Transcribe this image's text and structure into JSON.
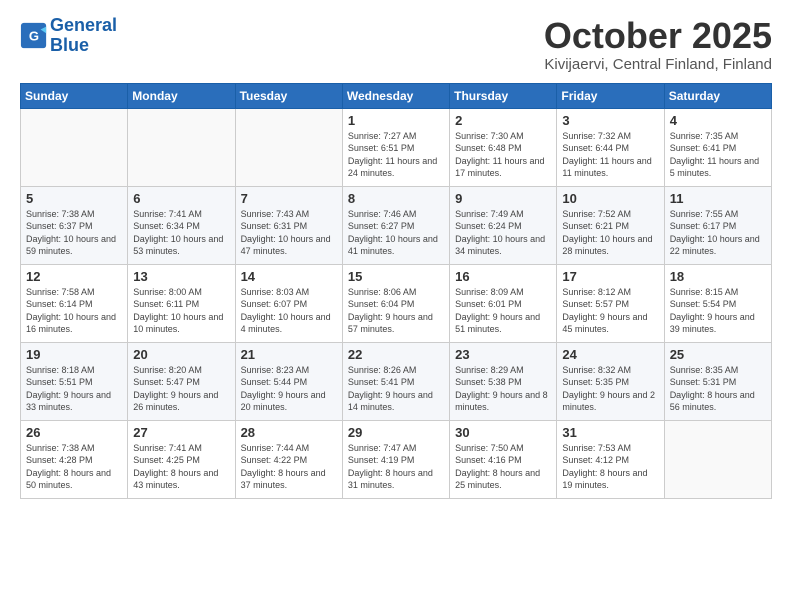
{
  "header": {
    "logo_line1": "General",
    "logo_line2": "Blue",
    "month": "October 2025",
    "location": "Kivijaervi, Central Finland, Finland"
  },
  "days_of_week": [
    "Sunday",
    "Monday",
    "Tuesday",
    "Wednesday",
    "Thursday",
    "Friday",
    "Saturday"
  ],
  "weeks": [
    [
      {
        "day": "",
        "info": ""
      },
      {
        "day": "",
        "info": ""
      },
      {
        "day": "",
        "info": ""
      },
      {
        "day": "1",
        "info": "Sunrise: 7:27 AM\nSunset: 6:51 PM\nDaylight: 11 hours\nand 24 minutes."
      },
      {
        "day": "2",
        "info": "Sunrise: 7:30 AM\nSunset: 6:48 PM\nDaylight: 11 hours\nand 17 minutes."
      },
      {
        "day": "3",
        "info": "Sunrise: 7:32 AM\nSunset: 6:44 PM\nDaylight: 11 hours\nand 11 minutes."
      },
      {
        "day": "4",
        "info": "Sunrise: 7:35 AM\nSunset: 6:41 PM\nDaylight: 11 hours\nand 5 minutes."
      }
    ],
    [
      {
        "day": "5",
        "info": "Sunrise: 7:38 AM\nSunset: 6:37 PM\nDaylight: 10 hours\nand 59 minutes."
      },
      {
        "day": "6",
        "info": "Sunrise: 7:41 AM\nSunset: 6:34 PM\nDaylight: 10 hours\nand 53 minutes."
      },
      {
        "day": "7",
        "info": "Sunrise: 7:43 AM\nSunset: 6:31 PM\nDaylight: 10 hours\nand 47 minutes."
      },
      {
        "day": "8",
        "info": "Sunrise: 7:46 AM\nSunset: 6:27 PM\nDaylight: 10 hours\nand 41 minutes."
      },
      {
        "day": "9",
        "info": "Sunrise: 7:49 AM\nSunset: 6:24 PM\nDaylight: 10 hours\nand 34 minutes."
      },
      {
        "day": "10",
        "info": "Sunrise: 7:52 AM\nSunset: 6:21 PM\nDaylight: 10 hours\nand 28 minutes."
      },
      {
        "day": "11",
        "info": "Sunrise: 7:55 AM\nSunset: 6:17 PM\nDaylight: 10 hours\nand 22 minutes."
      }
    ],
    [
      {
        "day": "12",
        "info": "Sunrise: 7:58 AM\nSunset: 6:14 PM\nDaylight: 10 hours\nand 16 minutes."
      },
      {
        "day": "13",
        "info": "Sunrise: 8:00 AM\nSunset: 6:11 PM\nDaylight: 10 hours\nand 10 minutes."
      },
      {
        "day": "14",
        "info": "Sunrise: 8:03 AM\nSunset: 6:07 PM\nDaylight: 10 hours\nand 4 minutes."
      },
      {
        "day": "15",
        "info": "Sunrise: 8:06 AM\nSunset: 6:04 PM\nDaylight: 9 hours\nand 57 minutes."
      },
      {
        "day": "16",
        "info": "Sunrise: 8:09 AM\nSunset: 6:01 PM\nDaylight: 9 hours\nand 51 minutes."
      },
      {
        "day": "17",
        "info": "Sunrise: 8:12 AM\nSunset: 5:57 PM\nDaylight: 9 hours\nand 45 minutes."
      },
      {
        "day": "18",
        "info": "Sunrise: 8:15 AM\nSunset: 5:54 PM\nDaylight: 9 hours\nand 39 minutes."
      }
    ],
    [
      {
        "day": "19",
        "info": "Sunrise: 8:18 AM\nSunset: 5:51 PM\nDaylight: 9 hours\nand 33 minutes."
      },
      {
        "day": "20",
        "info": "Sunrise: 8:20 AM\nSunset: 5:47 PM\nDaylight: 9 hours\nand 26 minutes."
      },
      {
        "day": "21",
        "info": "Sunrise: 8:23 AM\nSunset: 5:44 PM\nDaylight: 9 hours\nand 20 minutes."
      },
      {
        "day": "22",
        "info": "Sunrise: 8:26 AM\nSunset: 5:41 PM\nDaylight: 9 hours\nand 14 minutes."
      },
      {
        "day": "23",
        "info": "Sunrise: 8:29 AM\nSunset: 5:38 PM\nDaylight: 9 hours\nand 8 minutes."
      },
      {
        "day": "24",
        "info": "Sunrise: 8:32 AM\nSunset: 5:35 PM\nDaylight: 9 hours\nand 2 minutes."
      },
      {
        "day": "25",
        "info": "Sunrise: 8:35 AM\nSunset: 5:31 PM\nDaylight: 8 hours\nand 56 minutes."
      }
    ],
    [
      {
        "day": "26",
        "info": "Sunrise: 7:38 AM\nSunset: 4:28 PM\nDaylight: 8 hours\nand 50 minutes."
      },
      {
        "day": "27",
        "info": "Sunrise: 7:41 AM\nSunset: 4:25 PM\nDaylight: 8 hours\nand 43 minutes."
      },
      {
        "day": "28",
        "info": "Sunrise: 7:44 AM\nSunset: 4:22 PM\nDaylight: 8 hours\nand 37 minutes."
      },
      {
        "day": "29",
        "info": "Sunrise: 7:47 AM\nSunset: 4:19 PM\nDaylight: 8 hours\nand 31 minutes."
      },
      {
        "day": "30",
        "info": "Sunrise: 7:50 AM\nSunset: 4:16 PM\nDaylight: 8 hours\nand 25 minutes."
      },
      {
        "day": "31",
        "info": "Sunrise: 7:53 AM\nSunset: 4:12 PM\nDaylight: 8 hours\nand 19 minutes."
      },
      {
        "day": "",
        "info": ""
      }
    ]
  ]
}
